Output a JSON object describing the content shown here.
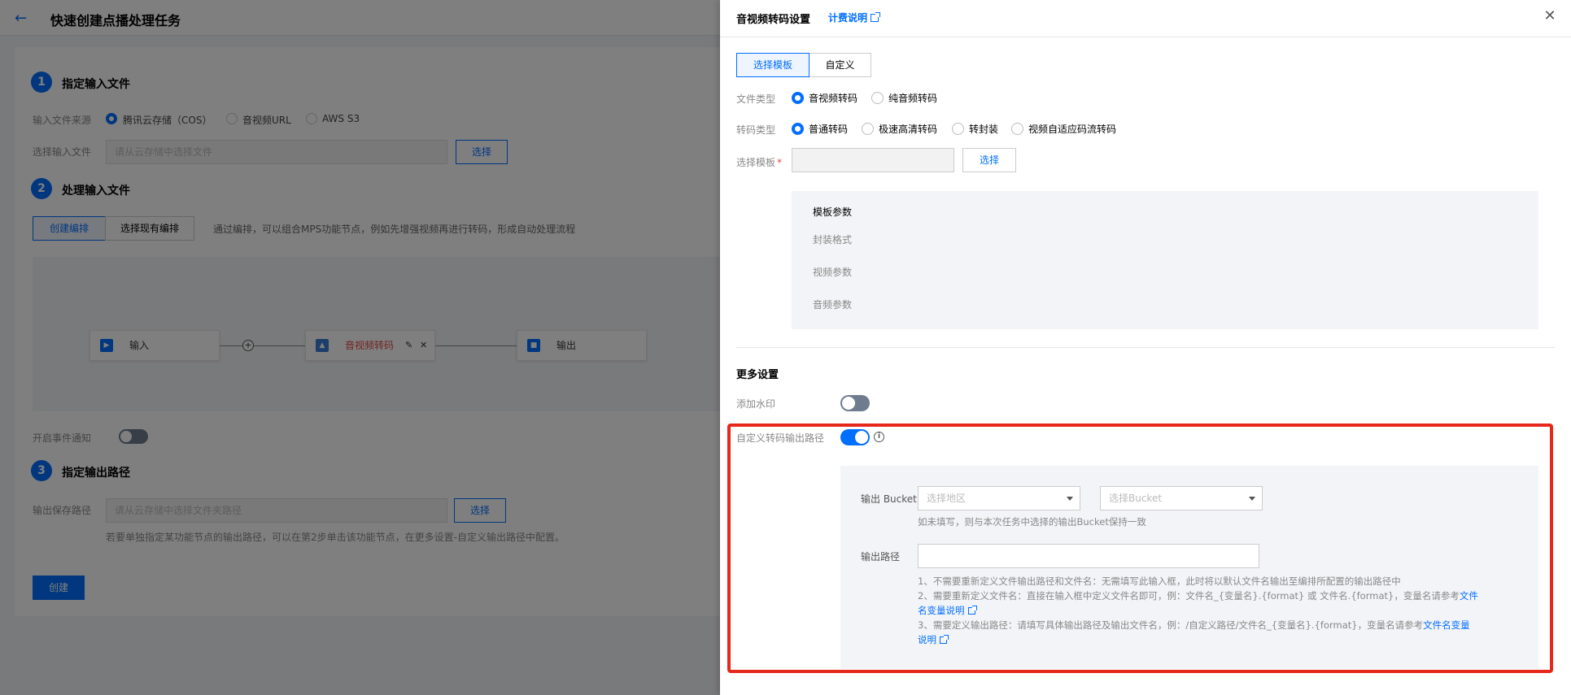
{
  "background": {
    "page_title": "快速创建点播处理任务",
    "step1": {
      "num": "1",
      "title": "指定输入文件",
      "source_label": "输入文件来源",
      "source_options": [
        "腾讯云存储（COS）",
        "音视频URL",
        "AWS S3"
      ],
      "file_label": "选择输入文件",
      "file_placeholder": "请从云存储中选择文件",
      "select_btn": "选择"
    },
    "step2": {
      "num": "2",
      "title": "处理输入文件",
      "tab_create": "创建编排",
      "tab_existing": "选择现有编排",
      "tab_desc": "通过编排，可以组合MPS功能节点，例如先增强视频再进行转码，形成自动处理流程",
      "node_input": "输入",
      "node_transcode": "音视频转码",
      "node_output": "输出"
    },
    "event_label": "开启事件通知",
    "step3": {
      "num": "3",
      "title": "指定输出路径",
      "path_label": "输出保存路径",
      "path_placeholder": "请从云存储中选择文件夹路径",
      "select_btn": "选择",
      "path_hint": "若要单独指定某功能节点的输出路径，可以在第2步单击该功能节点，在更多设置-自定义输出路径中配置。"
    },
    "create_btn": "创建"
  },
  "drawer": {
    "title": "音视频转码设置",
    "billing_link": "计费说明",
    "tabs": [
      "选择模板",
      "自定义"
    ],
    "file_type": {
      "label": "文件类型",
      "options": [
        "音视频转码",
        "纯音频转码"
      ],
      "selected": "音视频转码"
    },
    "transcode_type": {
      "label": "转码类型",
      "options": [
        "普通转码",
        "极速高清转码",
        "转封装",
        "视频自适应码流转码"
      ],
      "selected": "普通转码"
    },
    "template": {
      "label": "选择模板",
      "select_btn": "选择"
    },
    "params": {
      "title": "模板参数",
      "items": [
        "封装格式",
        "视频参数",
        "音频参数"
      ]
    },
    "more_settings": "更多设置",
    "watermark_label": "添加水印",
    "custom_path_label": "自定义转码输出路径",
    "output_bucket": {
      "label": "输出 Bucket",
      "region_placeholder": "选择地区",
      "bucket_placeholder": "选择Bucket",
      "hint": "如未填写，则与本次任务中选择的输出Bucket保持一致"
    },
    "output_path": {
      "label": "输出路径",
      "hint1": "1、不需要重新定义文件输出路径和文件名：无需填写此输入框，此时将以默认文件名输出至编排所配置的输出路径中",
      "hint2_text": "2、需要重新定义文件名：直接在输入框中定义文件名即可，例：文件名_{变量名}.{format} 或 文件名.{format}，变量名请参考",
      "hint2_link_a": "文件",
      "hint2_link_b": "名变量说明",
      "hint3_text": "3、需要定义输出路径：请填写具体输出路径及输出文件名，例：/自定义路径/文件名_{变量名}.{format}，变量名请参考",
      "hint3_link_a": "文件名变量",
      "hint3_link_b": "说明"
    }
  }
}
